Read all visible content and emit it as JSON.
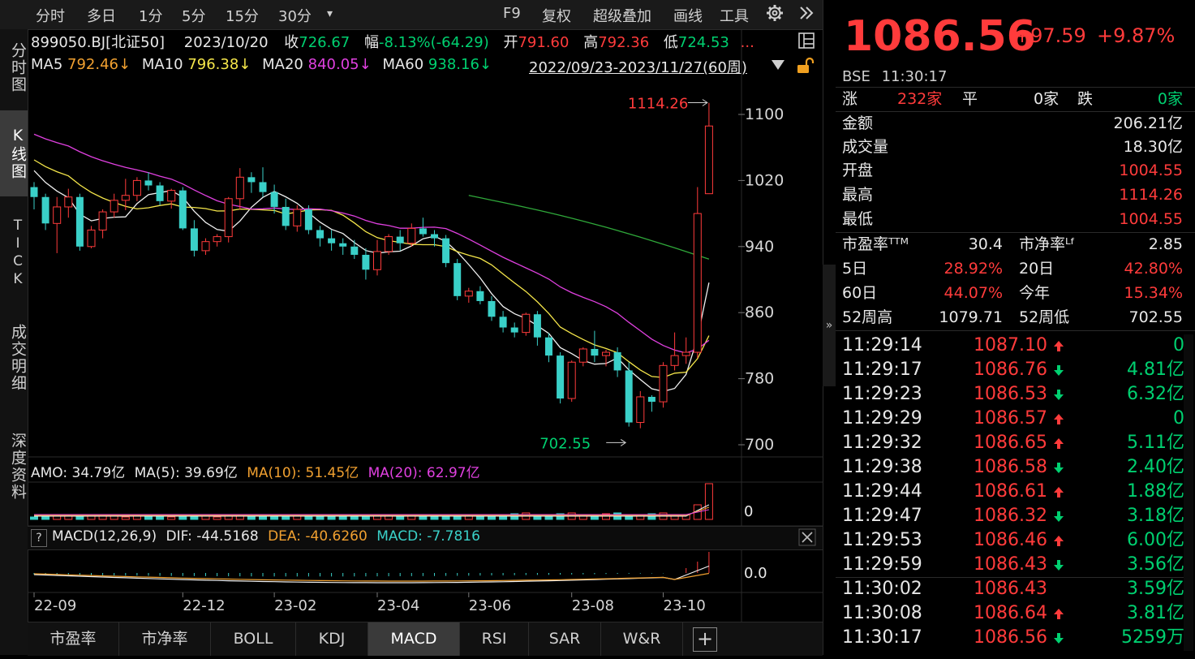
{
  "toolbar": {
    "tabs": [
      "分时",
      "多日",
      "1分",
      "5分",
      "15分",
      "30分"
    ],
    "more": "▾",
    "right_items": [
      "F9",
      "复权",
      "超级叠加",
      "画线",
      "工具"
    ]
  },
  "sidebar": [
    "分时图",
    "K线图",
    "TICK",
    "成交明细",
    "深度资料"
  ],
  "info": {
    "code": "899050.BJ[北证50]",
    "date": "2023/10/20",
    "close_label": "收",
    "close": "726.67",
    "change_label": "幅",
    "change": "-8.13%(-64.29)",
    "open_label": "开",
    "open": "791.60",
    "high_label": "高",
    "high": "792.36",
    "low_label": "低",
    "low": "724.53",
    "more": "..."
  },
  "ma": {
    "ma5": "MA5 ",
    "ma5v": "792.46↓",
    "ma10": "MA10 ",
    "ma10v": "796.38↓",
    "ma20": "MA20 ",
    "ma20v": "840.05↓",
    "ma60": "MA60 ",
    "ma60v": "938.16↓",
    "range": "2022/09/23-2023/11/27(60周)"
  },
  "annotations": {
    "high": "1114.26",
    "low": "702.55"
  },
  "volume_header": {
    "amo": "AMO: 34.79亿",
    "ma5": "MA(5): 39.69亿",
    "ma10": "MA(10): 51.45亿",
    "ma20": "MA(20): 62.97亿",
    "zero": "0"
  },
  "macd_header": {
    "help": "?",
    "name": "MACD(12,26,9)",
    "dif": "DIF: -44.5168",
    "dea": "DEA: -40.6260",
    "macd": "MACD: -7.7816",
    "zero": "0.0"
  },
  "y_ticks": [
    "1100",
    "1020",
    "940",
    "860",
    "780",
    "700"
  ],
  "x_ticks": [
    "22-09",
    "22-12",
    "23-02",
    "23-04",
    "23-06",
    "23-08",
    "23-10"
  ],
  "bottom_tabs": [
    "市盈率",
    "市净率",
    "BOLL",
    "KDJ",
    "MACD",
    "RSI",
    "SAR",
    "W&R",
    "+"
  ],
  "quote": {
    "price": "1086.56",
    "change": "+97.59",
    "pct": "+9.87%",
    "exchange": "BSE",
    "time": "11:30:17",
    "up_label": "涨",
    "up": "232家",
    "flat_label": "平",
    "flat": "0家",
    "down_label": "跌",
    "down": "0家",
    "amount_label": "金额",
    "amount": "206.21亿",
    "volume_label": "成交量",
    "volume": "18.30亿",
    "open_label": "开盘",
    "open": "1004.55",
    "high_label": "最高",
    "high": "1114.26",
    "low_label": "最低",
    "low": "1004.55",
    "pe_label": "市盈率ᵀᵀᴹ",
    "pe": "30.4",
    "pb_label": "市净率ᴸᶠ",
    "pb": "2.85",
    "d5_label": "5日",
    "d5": "28.92%",
    "d20_label": "20日",
    "d20": "42.80%",
    "d60_label": "60日",
    "d60": "44.07%",
    "ytd_label": "今年",
    "ytd": "15.34%",
    "w52h_label": "52周高",
    "w52h": "1079.71",
    "w52l_label": "52周低",
    "w52l": "702.55"
  },
  "ticks": [
    {
      "time": "11:29:14",
      "price": "1087.10",
      "dir": "up",
      "vol": "0",
      "vc": "green"
    },
    {
      "time": "11:29:17",
      "price": "1086.76",
      "dir": "down",
      "vol": "4.81亿",
      "vc": "green"
    },
    {
      "time": "11:29:23",
      "price": "1086.53",
      "dir": "down",
      "vol": "6.32亿",
      "vc": "green"
    },
    {
      "time": "11:29:29",
      "price": "1086.57",
      "dir": "up",
      "vol": "0",
      "vc": "green"
    },
    {
      "time": "11:29:32",
      "price": "1086.65",
      "dir": "up",
      "vol": "5.11亿",
      "vc": "green"
    },
    {
      "time": "11:29:38",
      "price": "1086.58",
      "dir": "down",
      "vol": "2.40亿",
      "vc": "green"
    },
    {
      "time": "11:29:44",
      "price": "1086.61",
      "dir": "up",
      "vol": "1.88亿",
      "vc": "green"
    },
    {
      "time": "11:29:47",
      "price": "1086.32",
      "dir": "down",
      "vol": "3.18亿",
      "vc": "green"
    },
    {
      "time": "11:29:53",
      "price": "1086.46",
      "dir": "up",
      "vol": "6.00亿",
      "vc": "green"
    },
    {
      "time": "11:29:59",
      "price": "1086.43",
      "dir": "down",
      "vol": "3.56亿",
      "vc": "green"
    },
    {
      "time": "11:30:02",
      "price": "1086.43",
      "dir": "",
      "vol": "3.59亿",
      "vc": "green"
    },
    {
      "time": "11:30:08",
      "price": "1086.64",
      "dir": "up",
      "vol": "3.81亿",
      "vc": "green"
    },
    {
      "time": "11:30:17",
      "price": "1086.56",
      "dir": "down",
      "vol": "5259万",
      "vc": "green"
    }
  ],
  "colors": {
    "up": "#ff3b3b",
    "down": "#00d070",
    "candle_down": "#3ad0c8",
    "ma5": "#f0f0f0",
    "ma10": "#f5e64a",
    "ma20": "#e040e0",
    "ma60": "#2fa83a"
  }
}
